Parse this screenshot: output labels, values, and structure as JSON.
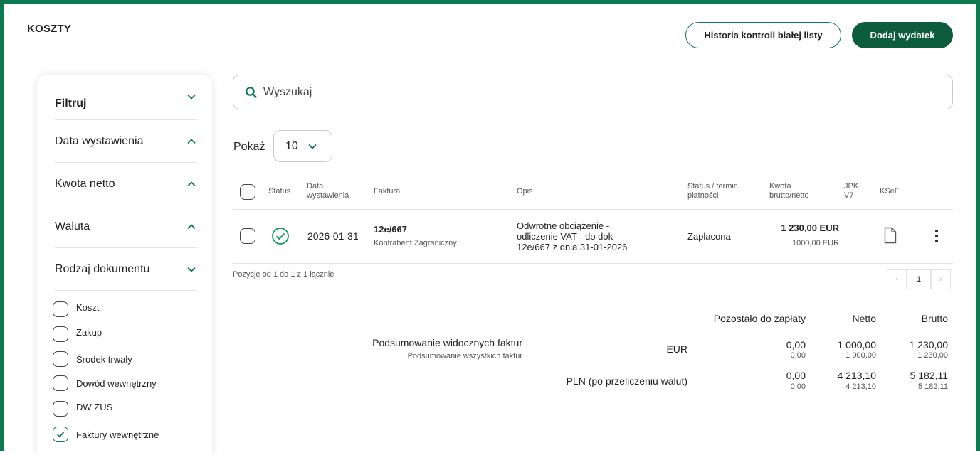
{
  "header": {
    "title": "KOSZTY",
    "history_button": "Historia kontroli białej listy",
    "add_button": "Dodaj wydatek"
  },
  "colors": {
    "accent": "#0d7a52",
    "primary_button": "#0d5c3e"
  },
  "filters": {
    "title": "Filtruj",
    "sections": [
      {
        "label": "Data wystawienia",
        "icon": "chevron-up-icon"
      },
      {
        "label": "Kwota netto",
        "icon": "chevron-up-icon"
      },
      {
        "label": "Waluta",
        "icon": "chevron-up-icon"
      },
      {
        "label": "Rodzaj dokumentu",
        "icon": "chevron-down-icon"
      }
    ],
    "doc_types": [
      {
        "label": "Koszt",
        "checked": false
      },
      {
        "label": "Zakup",
        "checked": false
      },
      {
        "label": "Środek trwały",
        "checked": false
      },
      {
        "label": "Dowód wewnętrzny",
        "checked": false
      },
      {
        "label": "DW ZUS",
        "checked": false
      },
      {
        "label": "Faktury wewnętrzne",
        "checked": true
      }
    ]
  },
  "search": {
    "placeholder": "Wyszukaj"
  },
  "pagesize": {
    "label": "Pokaż",
    "value": "10"
  },
  "table": {
    "headers": {
      "status": "Status",
      "date": "Data wystawienia",
      "invoice": "Faktura",
      "desc": "Opis",
      "status_due": "Status / termin płatności",
      "amount": "Kwota brutto/netto",
      "jpk": "JPK V7",
      "ksef": "KSeF"
    },
    "rows": [
      {
        "date": "2026-01-31",
        "invoice": "12e/667",
        "contractor": "Kontrahent Zagraniczny",
        "desc_lines": [
          "Odwrotne obciążenie -",
          "odliczenie VAT - do dok",
          "12e/667 z dnia 31-01-2026"
        ],
        "status": "Zapłacona",
        "gross": "1 230,00 EUR",
        "net": "1000,00 EUR"
      }
    ],
    "footer": "Pozycje od 1 do 1 z 1 łącznie",
    "page": "1"
  },
  "summary": {
    "col_remaining": "Pozostało do zapłaty",
    "col_net": "Netto",
    "col_gross": "Brutto",
    "label_visible": "Podsumowanie widocznych faktur",
    "label_all": "Podsumowanie wszystkich faktur",
    "eur": {
      "label": "EUR",
      "remaining": "0,00",
      "remaining_all": "0,00",
      "net": "1 000,00",
      "net_all": "1 000,00",
      "gross": "1 230,00",
      "gross_all": "1 230,00"
    },
    "pln": {
      "label": "PLN (po przeliczeniu walut)",
      "remaining": "0,00",
      "remaining_all": "0,00",
      "net": "4 213,10",
      "net_all": "4 213,10",
      "gross": "5 182,11",
      "gross_all": "5 182,11"
    }
  }
}
